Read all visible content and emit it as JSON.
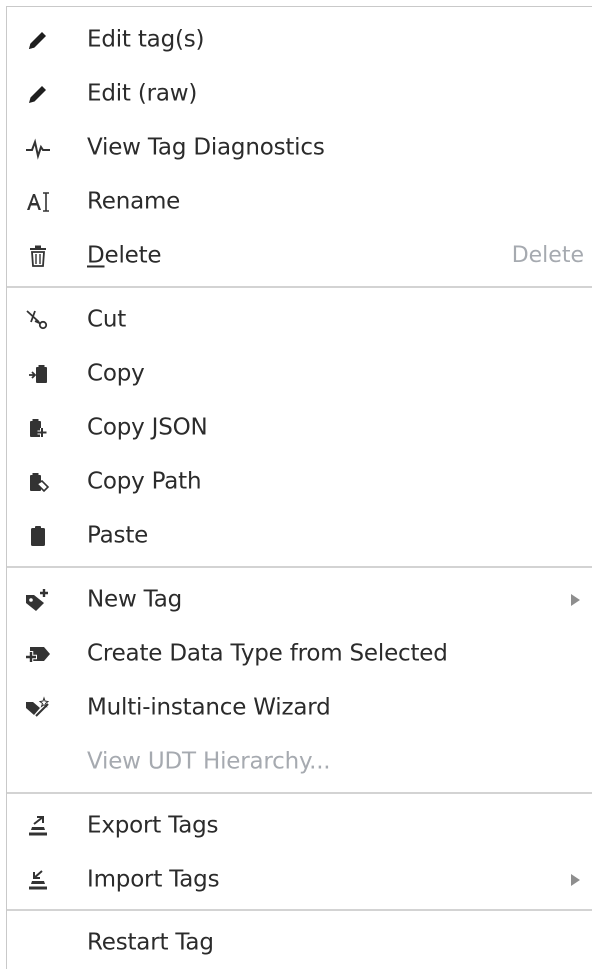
{
  "menu": {
    "groups": [
      {
        "items": [
          {
            "label": "Edit tag(s)",
            "icon": "pencil-icon"
          },
          {
            "label": "Edit (raw)",
            "icon": "pencil-icon"
          },
          {
            "label": "View Tag Diagnostics",
            "icon": "pulse-icon"
          },
          {
            "label": "Rename",
            "icon": "rename-icon"
          },
          {
            "label": "Delete",
            "icon": "trash-icon",
            "shortcut": "Delete",
            "mnemonic": "D"
          }
        ]
      },
      {
        "items": [
          {
            "label": "Cut",
            "icon": "scissors-icon"
          },
          {
            "label": "Copy",
            "icon": "copy-icon"
          },
          {
            "label": "Copy JSON",
            "icon": "copy-json-icon"
          },
          {
            "label": "Copy Path",
            "icon": "copy-path-icon"
          },
          {
            "label": "Paste",
            "icon": "clipboard-icon"
          }
        ]
      },
      {
        "items": [
          {
            "label": "New Tag",
            "icon": "new-tag-icon",
            "submenu": true
          },
          {
            "label": "Create Data Type from Selected",
            "icon": "create-data-type-icon"
          },
          {
            "label": "Multi-instance Wizard",
            "icon": "wizard-icon"
          },
          {
            "label": "View UDT Hierarchy...",
            "disabled": true
          }
        ]
      },
      {
        "items": [
          {
            "label": "Export Tags",
            "icon": "export-icon"
          },
          {
            "label": "Import Tags",
            "icon": "import-icon",
            "submenu": true
          }
        ]
      },
      {
        "items": [
          {
            "label": "Restart Tag"
          }
        ]
      }
    ],
    "colors": {
      "text": "#2b2b2b",
      "disabled": "#a6aab0",
      "separator": "#d3d3d3",
      "icon": "#2b2b2b"
    }
  }
}
